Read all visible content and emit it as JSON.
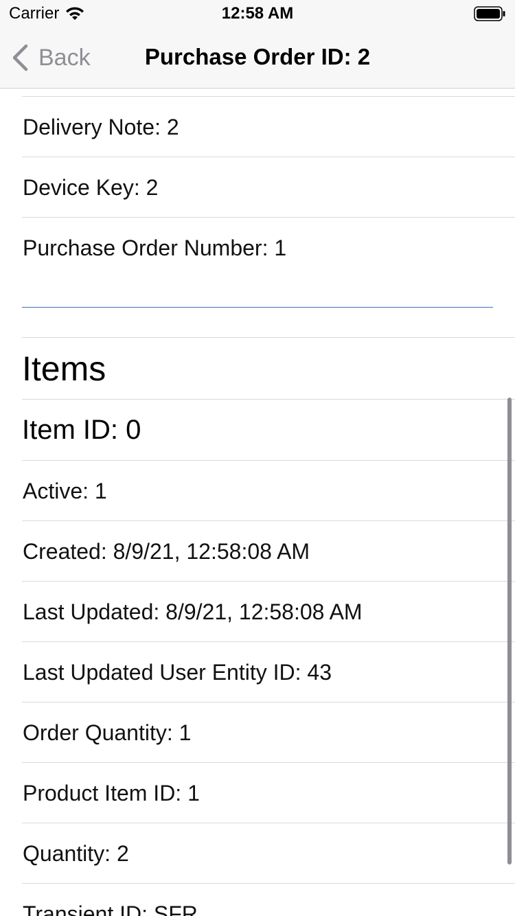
{
  "status_bar": {
    "carrier": "Carrier",
    "time": "12:58 AM"
  },
  "nav": {
    "back_label": "Back",
    "title": "Purchase Order ID: 2"
  },
  "fields": [
    {
      "label": "Delivery Note: 2"
    },
    {
      "label": "Device Key: 2"
    },
    {
      "label": "Purchase Order Number: 1"
    }
  ],
  "items_section": {
    "title": "Items",
    "item_title": "Item ID: 0",
    "rows": [
      {
        "label": "Active: 1"
      },
      {
        "label": "Created: 8/9/21, 12:58:08 AM"
      },
      {
        "label": "Last Updated: 8/9/21, 12:58:08 AM"
      },
      {
        "label": "Last Updated User Entity ID: 43"
      },
      {
        "label": "Order Quantity: 1"
      },
      {
        "label": "Product Item ID: 1"
      },
      {
        "label": "Quantity: 2"
      },
      {
        "label": "Transient ID: SFR"
      }
    ]
  },
  "colors": {
    "accent_line": "#3a6fc9",
    "bar_background": "#f7f7f7",
    "back_gray": "#8e8e93"
  }
}
